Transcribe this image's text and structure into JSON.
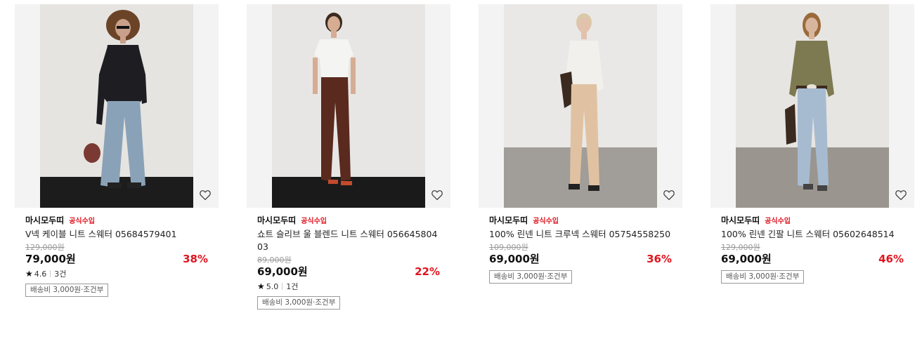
{
  "products": [
    {
      "brand": "마시모두띠",
      "badge": "공식수입",
      "title": "V넥 케이블 니트 스웨터 05684579401",
      "original_price": "129,000원",
      "price": "79,000원",
      "discount": "38%",
      "rating": "4.6",
      "reviews": "3건",
      "shipping": "배송비 3,000원·조건부",
      "colors": {
        "wall": "#e6e4e1",
        "floor": "#1c1c1c",
        "top": "#1d1d22",
        "bottom": "#8aa2b8",
        "skin": "#c9a089",
        "hair": "#6b4428"
      }
    },
    {
      "brand": "마시모두띠",
      "badge": "공식수입",
      "title": "쇼트 슬리브 울 블렌드 니트 스웨터 05664580403",
      "original_price": "89,000원",
      "price": "69,000원",
      "discount": "22%",
      "rating": "5.0",
      "reviews": "1건",
      "shipping": "배송비 3,000원·조건부",
      "colors": {
        "wall": "#e8e6e4",
        "floor": "#1a1a1a",
        "top": "#f4f4f2",
        "bottom": "#5a2a1e",
        "skin": "#d6ad92",
        "hair": "#3a2a20"
      }
    },
    {
      "brand": "마시모두띠",
      "badge": "공식수입",
      "title": "100% 린넨 니트 크루넥 스웨터 05754558250",
      "original_price": "109,000원",
      "price": "69,000원",
      "discount": "36%",
      "shipping": "배송비 3,000원·조건부",
      "colors": {
        "wall": "#e9e8e6",
        "floor": "#a19d98",
        "top": "#f2f0ec",
        "bottom": "#e0c2a2",
        "skin": "#e2c2ad",
        "hair": "#d9c9a6"
      }
    },
    {
      "brand": "마시모두띠",
      "badge": "공식수입",
      "title": "100% 린넨 긴팔 니트 스웨터 05602648514",
      "original_price": "129,000원",
      "price": "69,000원",
      "discount": "46%",
      "shipping": "배송비 3,000원·조건부",
      "colors": {
        "wall": "#e7e5e1",
        "floor": "#9a958f",
        "top": "#7d7a52",
        "bottom": "#a7bbd0",
        "skin": "#d8b59d",
        "hair": "#9a6a3a"
      }
    }
  ]
}
